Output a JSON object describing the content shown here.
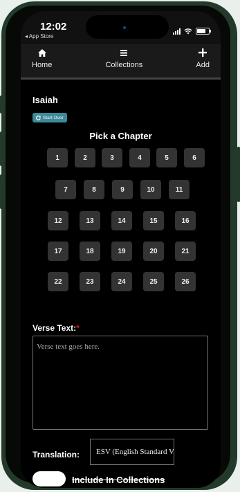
{
  "status_bar": {
    "time": "12:02",
    "back_app": "◂ App Store"
  },
  "nav": {
    "items": [
      {
        "label": "Home",
        "icon": "home-icon"
      },
      {
        "label": "Collections",
        "icon": "menu-icon"
      },
      {
        "label": "Add",
        "icon": "plus-icon"
      }
    ]
  },
  "book": {
    "title": "Isaiah",
    "start_over_label": "Start Over"
  },
  "chapters": {
    "heading": "Pick a Chapter",
    "rows": [
      [
        "1",
        "2",
        "3",
        "4",
        "5",
        "6"
      ],
      [
        "7",
        "8",
        "9",
        "10",
        "11"
      ],
      [
        "12",
        "13",
        "14",
        "15",
        "16"
      ],
      [
        "17",
        "18",
        "19",
        "20",
        "21"
      ],
      [
        "22",
        "23",
        "24",
        "25",
        "26"
      ]
    ]
  },
  "verse": {
    "label": "Verse Text:",
    "required_mark": "*",
    "placeholder": "Verse text goes here."
  },
  "translation": {
    "label": "Translation:",
    "selected": "ESV (English Standard Version)"
  },
  "collections_toggle": {
    "label": "Include In Collections"
  },
  "colors": {
    "frame": "#233a2b",
    "start_over": "#3e8a98",
    "chapter_button": "#333333",
    "required": "#d02020"
  }
}
